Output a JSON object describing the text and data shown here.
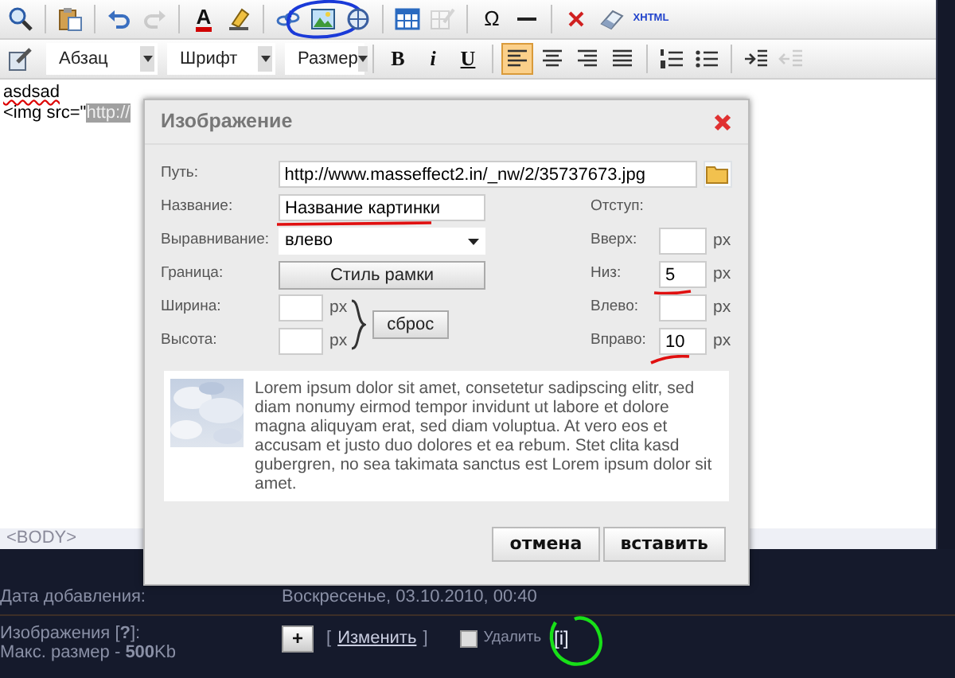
{
  "toolbar_1": [
    {
      "kind": "icon",
      "disabled": false
    },
    {
      "kind": "separator"
    },
    {
      "kind": "icon",
      "disabled": false
    },
    {
      "kind": "separator"
    },
    {
      "kind": "icon",
      "disabled": false
    },
    {
      "kind": "icon",
      "disabled": true
    },
    {
      "kind": "separator"
    },
    {
      "kind": "font-color",
      "label": "A",
      "disabled": false
    },
    {
      "kind": "icon",
      "disabled": false
    },
    {
      "kind": "separator"
    },
    {
      "kind": "icon",
      "disabled": false
    },
    {
      "kind": "icon",
      "disabled": false
    },
    {
      "kind": "icon",
      "disabled": false
    },
    {
      "kind": "separator"
    },
    {
      "kind": "icon",
      "disabled": false
    },
    {
      "kind": "icon",
      "disabled": true
    },
    {
      "kind": "separator"
    },
    {
      "kind": "symbol",
      "label": "Ω",
      "disabled": false
    },
    {
      "kind": "icon",
      "disabled": false
    },
    {
      "kind": "separator"
    },
    {
      "kind": "icon",
      "disabled": false
    },
    {
      "kind": "icon",
      "disabled": false
    },
    {
      "kind": "tiny-text",
      "label": "XHTML",
      "disabled": false
    }
  ],
  "toolbar_2": [
    {
      "kind": "icon",
      "active": false,
      "disabled": false
    },
    {
      "kind": "dropdown",
      "label": "Абзац"
    },
    {
      "kind": "dropdown",
      "label": "Шрифт"
    },
    {
      "kind": "dropdown",
      "label": "Размер"
    },
    {
      "kind": "separator"
    },
    {
      "kind": "text",
      "label": "B",
      "active": false,
      "disabled": false
    },
    {
      "kind": "text",
      "label": "i",
      "active": false,
      "disabled": false
    },
    {
      "kind": "text",
      "label": "U",
      "active": false,
      "disabled": false
    },
    {
      "kind": "separator"
    },
    {
      "kind": "icon",
      "active": true,
      "disabled": false
    },
    {
      "kind": "icon",
      "active": false,
      "disabled": false
    },
    {
      "kind": "icon",
      "active": false,
      "disabled": false
    },
    {
      "kind": "icon",
      "active": false,
      "disabled": false
    },
    {
      "kind": "separator"
    },
    {
      "kind": "icon",
      "active": false,
      "disabled": false
    },
    {
      "kind": "icon",
      "active": false,
      "disabled": false
    },
    {
      "kind": "separator"
    },
    {
      "kind": "icon",
      "active": false,
      "disabled": false
    },
    {
      "kind": "icon",
      "active": false,
      "disabled": true
    }
  ],
  "editor": {
    "lines": [
      [
        {
          "text": "asdsad",
          "selected": false
        }
      ],
      [
        {
          "text": "<img src=\"",
          "selected": false
        },
        {
          "text": "http://",
          "selected": true
        }
      ]
    ],
    "status": "<BODY>"
  },
  "dialog": {
    "title": "Изображение",
    "path": {
      "label": "Путь:",
      "value": "http://www.masseffect2.in/_nw/2/35737673.jpg"
    },
    "name": {
      "label": "Название:",
      "value": "Название картинки"
    },
    "align": {
      "label": "Выравнивание:",
      "value": "влево"
    },
    "border": {
      "label": "Граница:",
      "button": "Стиль рамки"
    },
    "width": {
      "label": "Ширина:",
      "unit": "px"
    },
    "height": {
      "label": "Высота:",
      "unit": "px"
    },
    "reset_button": "сброс",
    "indent": {
      "label": "Отступ:",
      "fields": [
        {
          "label": "Вверх:",
          "unit": "px"
        },
        {
          "label": "Низ:",
          "value": "5",
          "unit": "px"
        },
        {
          "label": "Влево:",
          "unit": "px"
        },
        {
          "label": "Вправо:",
          "value": "10",
          "unit": "px"
        }
      ]
    },
    "preview_text": "Lorem ipsum dolor sit amet, consetetur sadipscing elitr, sed diam nonumy eirmod tempor invidunt ut labore et dolore magna aliquyam erat, sed diam voluptua. At vero eos et accusam et justo duo dolores et ea rebum. Stet clita kasd gubergren, no sea takimata sanctus est Lorem ipsum dolor sit amet.",
    "buttons": [
      "отмена",
      "вставить"
    ]
  },
  "form": {
    "date_label": "Дата добавления:",
    "date_value": "Воскресенье, 03.10.2010, 00:40",
    "images_label": "Изображения [**?**]:",
    "max_size": "Макс. размер - **500**Kb",
    "add_button": "+",
    "open_bracket": "[",
    "change_link": "Изменить",
    "close_bracket": "]",
    "delete": {
      "label": "Удалить",
      "checked": false
    },
    "info": "[i]"
  }
}
